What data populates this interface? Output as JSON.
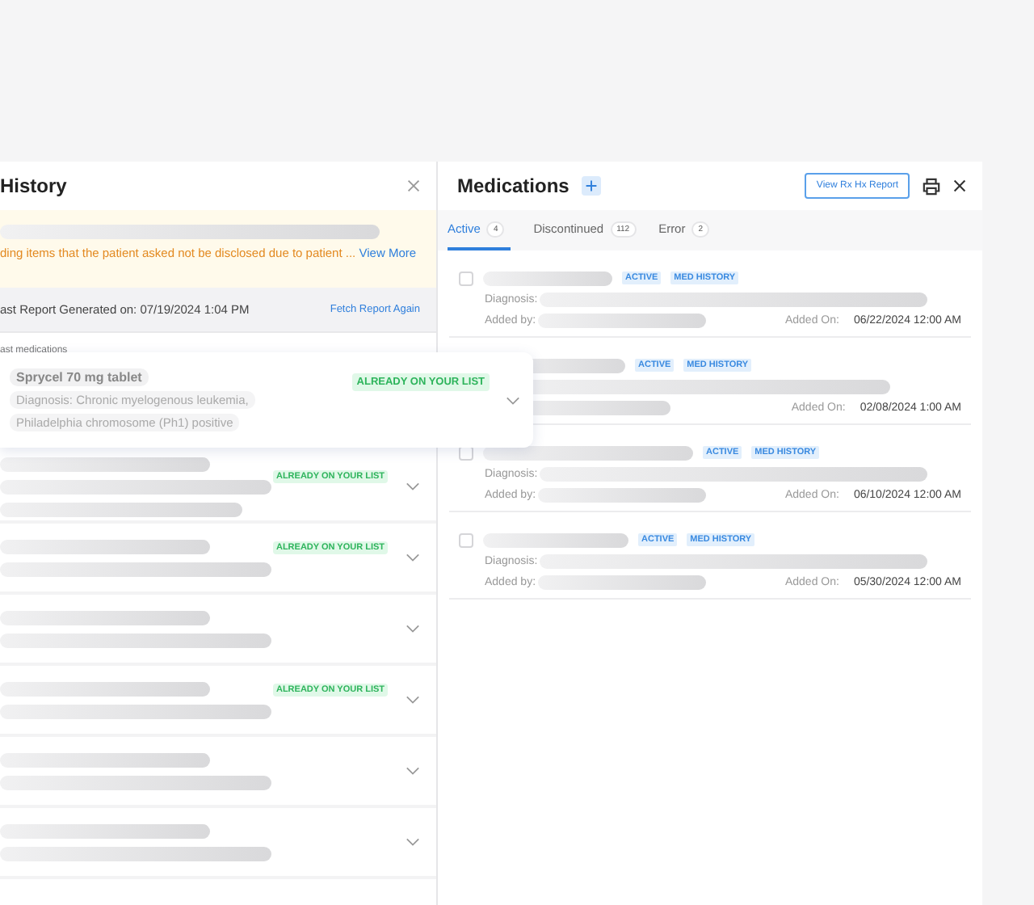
{
  "history_panel": {
    "title": "History",
    "warning": {
      "text": "ding items that the patient asked not be disclosed due to patient ...",
      "link": "View More"
    },
    "report": {
      "text": "ast Report Generated on: 07/19/2024 1:04 PM",
      "action": "Fetch Report Again"
    },
    "section_label": "ast medications",
    "popup_card": {
      "name": "Sprycel 70 mg tablet",
      "diagnosis": "Diagnosis: Chronic myelogenous leukemia,",
      "diagnosis_2": "Philadelphia chromosome (Ph1) positive",
      "badge": "ALREADY ON YOUR LIST"
    },
    "rows": [
      {
        "badge": "ALREADY ON YOUR LIST"
      },
      {
        "badge": "ALREADY ON YOUR LIST"
      },
      {},
      {
        "badge": "ALREADY ON YOUR LIST"
      },
      {},
      {}
    ]
  },
  "medications_panel": {
    "title": "Medications",
    "report_button": "View Rx Hx Report",
    "tabs": [
      {
        "label": "Active",
        "count": "4",
        "selected": true
      },
      {
        "label": "Discontinued",
        "count": "112",
        "selected": false
      },
      {
        "label": "Error",
        "count": "2",
        "selected": false
      }
    ],
    "items": [
      {
        "checked": false,
        "tags": [
          "ACTIVE",
          "MED HISTORY"
        ],
        "diagnosis_label": "Diagnosis:",
        "added_by_label": "Added by:",
        "added_on_label": "Added On:",
        "added_on": "06/22/2024 12:00 AM"
      },
      {
        "tags": [
          "ACTIVE",
          "MED HISTORY"
        ],
        "added_on_label": "Added On:",
        "added_on": "02/08/2024 1:00 AM"
      },
      {
        "checked": false,
        "tags": [
          "ACTIVE",
          "MED HISTORY"
        ],
        "diagnosis_label": "Diagnosis:",
        "added_by_label": "Added by:",
        "added_on_label": "Added On:",
        "added_on": "06/10/2024 12:00 AM"
      },
      {
        "checked": false,
        "tags": [
          "ACTIVE",
          "MED HISTORY"
        ],
        "diagnosis_label": "Diagnosis:",
        "added_by_label": "Added by:",
        "added_on_label": "Added On:",
        "added_on": "05/30/2024 12:00 AM"
      }
    ]
  }
}
